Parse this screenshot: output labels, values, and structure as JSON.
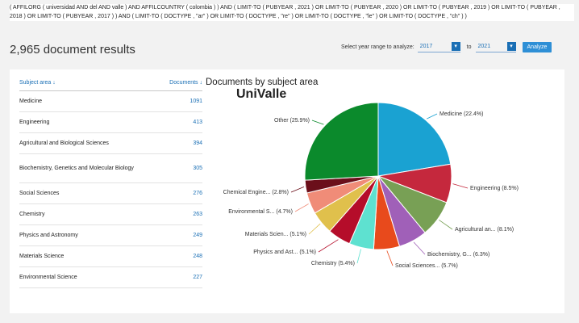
{
  "query": "( AFFILORG ( universidad  AND del  AND valle )  AND  AFFILCOUNTRY ( colombia ) )  AND  ( LIMIT-TO ( PUBYEAR ,  2021 )  OR  LIMIT-TO ( PUBYEAR ,  2020 )  OR  LIMIT-TO ( PUBYEAR ,  2019 )  OR  LIMIT-TO ( PUBYEAR ,  2018 )  OR  LIMIT-TO ( PUBYEAR ,  2017 ) )  AND  ( LIMIT-TO ( DOCTYPE ,  \"ar\" )  OR  LIMIT-TO ( DOCTYPE ,  \"re\" )  OR  LIMIT-TO ( DOCTYPE ,  \"le\" )  OR  LIMIT-TO ( DOCTYPE ,  \"ch\" ) )",
  "results_title": "2,965 document results",
  "year_range": {
    "label": "Select year range to analyze:",
    "from": "2017",
    "to_label": "to",
    "to": "2021",
    "analyze_label": "Analyze"
  },
  "table": {
    "col_subject": "Subject area ↓",
    "col_documents": "Documents ↓",
    "rows": [
      {
        "name": "Medicine",
        "count": "1091"
      },
      {
        "name": "Engineering",
        "count": "413"
      },
      {
        "name": "Agricultural and Biological Sciences",
        "count": "394"
      },
      {
        "name": "Biochemistry, Genetics and Molecular Biology",
        "count": "305"
      },
      {
        "name": "Social Sciences",
        "count": "276"
      },
      {
        "name": "Chemistry",
        "count": "263"
      },
      {
        "name": "Physics and Astronomy",
        "count": "249"
      },
      {
        "name": "Materials Science",
        "count": "248"
      },
      {
        "name": "Environmental Science",
        "count": "227"
      }
    ]
  },
  "chart_title": "Documents by subject area",
  "brand": "UniValle",
  "chart_data": {
    "type": "pie",
    "title": "Documents by subject area",
    "slices": [
      {
        "label": "Medicine (22.4%)",
        "value": 22.4,
        "color": "#1aa2d2"
      },
      {
        "label": "Engineering (8.5%)",
        "value": 8.5,
        "color": "#c5283d"
      },
      {
        "label": "Agricultural an... (8.1%)",
        "value": 8.1,
        "color": "#78a055"
      },
      {
        "label": "Biochemistry, G... (6.3%)",
        "value": 6.3,
        "color": "#a060b8"
      },
      {
        "label": "Social Sciences... (5.7%)",
        "value": 5.7,
        "color": "#e84a1c"
      },
      {
        "label": "Chemistry (5.4%)",
        "value": 5.4,
        "color": "#5ee1d0"
      },
      {
        "label": "Physics and Ast... (5.1%)",
        "value": 5.1,
        "color": "#b50d2a"
      },
      {
        "label": "Materials Scien... (5.1%)",
        "value": 5.1,
        "color": "#e0c04c"
      },
      {
        "label": "Environmental S... (4.7%)",
        "value": 4.7,
        "color": "#f08c78"
      },
      {
        "label": "Chemical Engine... (2.8%)",
        "value": 2.8,
        "color": "#6b0f1a"
      },
      {
        "label": "Other (25.9%)",
        "value": 25.9,
        "color": "#0b8a2c"
      }
    ]
  }
}
